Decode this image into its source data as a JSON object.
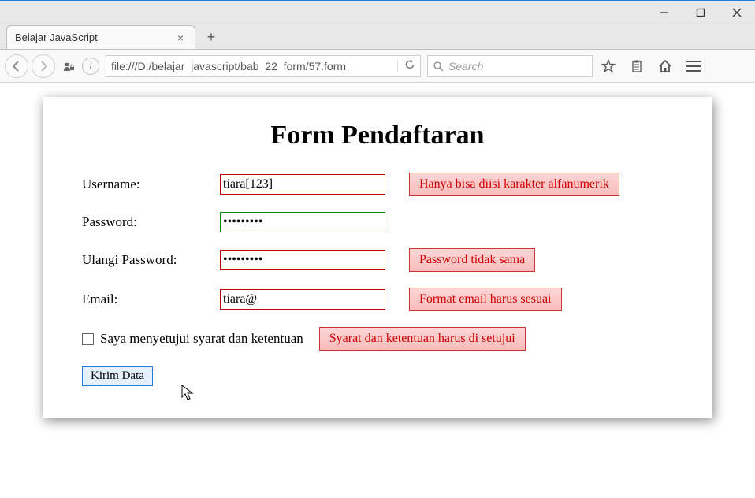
{
  "window": {
    "title": "Belajar JavaScript"
  },
  "toolbar": {
    "url": "file:///D:/belajar_javascript/bab_22_form/57.form_",
    "search_placeholder": "Search"
  },
  "form": {
    "heading": "Form Pendaftaran",
    "username": {
      "label": "Username:",
      "value": "tiara[123]",
      "error": "Hanya bisa diisi karakter alfanumerik"
    },
    "password": {
      "label": "Password:",
      "value": "•••••••••"
    },
    "password2": {
      "label": "Ulangi Password:",
      "value": "•••••••••",
      "error": "Password tidak sama"
    },
    "email": {
      "label": "Email:",
      "value": "tiara@",
      "error": "Format email harus sesuai"
    },
    "agree": {
      "label": "Saya menyetujui syarat dan ketentuan",
      "error": "Syarat dan ketentuan harus di setujui"
    },
    "submit": "Kirim Data"
  }
}
